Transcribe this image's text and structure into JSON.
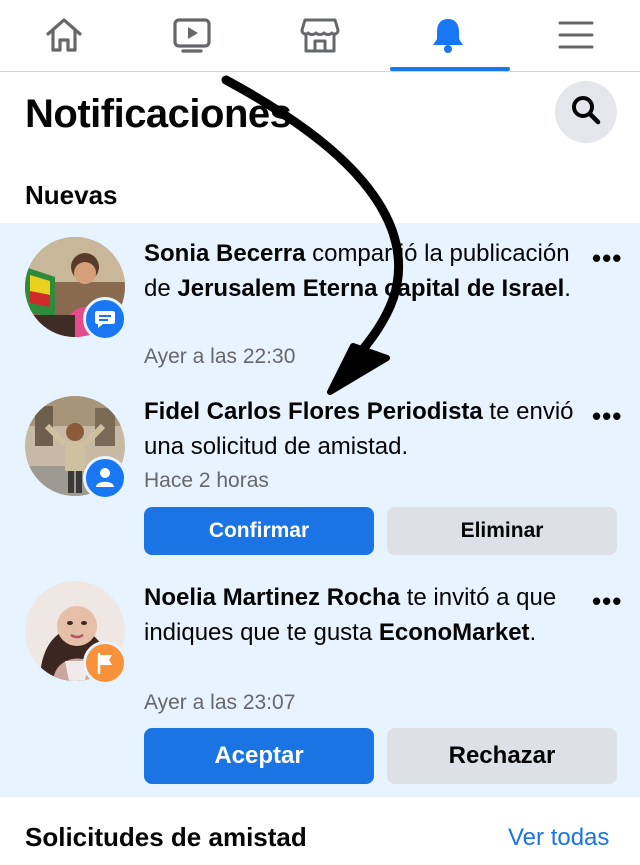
{
  "nav": {
    "items": [
      {
        "icon": "home-icon",
        "active": false
      },
      {
        "icon": "video-icon",
        "active": false
      },
      {
        "icon": "marketplace-icon",
        "active": false
      },
      {
        "icon": "bell-icon",
        "active": true
      },
      {
        "icon": "menu-icon",
        "active": false
      }
    ],
    "active_color": "#1877f2"
  },
  "header": {
    "title": "Notificaciones"
  },
  "section_new": {
    "label": "Nuevas"
  },
  "notifications": [
    {
      "actor": "Sonia Becerra",
      "text_1": " compartió la publicación de ",
      "target": "Jerusalem Eterna capital de Israel",
      "text_2": ".",
      "time": "Ayer a las 22:30",
      "badge_icon": "comment-badge-icon",
      "badge_color": "#1877f2",
      "more": "•••"
    },
    {
      "actor": "Fidel Carlos Flores Periodista",
      "text_1": " te envió una solicitud de amistad.",
      "time": "Hace 2 horas",
      "badge_icon": "friend-badge-icon",
      "badge_color": "#1877f2",
      "more": "•••",
      "primary_button": "Confirmar",
      "secondary_button": "Eliminar"
    },
    {
      "actor": "Noelia Martinez Rocha",
      "text_1": " te invitó a que indiques que te gusta ",
      "target": "EconoMarket",
      "text_2": ".",
      "time": "Ayer a las 23:07",
      "badge_icon": "page-flag-badge-icon",
      "badge_color": "#f7923a",
      "more": "•••",
      "primary_button": "Aceptar",
      "secondary_button": "Rechazar"
    }
  ],
  "friend_requests": {
    "title": "Solicitudes de amistad",
    "see_all": "Ver todas"
  }
}
